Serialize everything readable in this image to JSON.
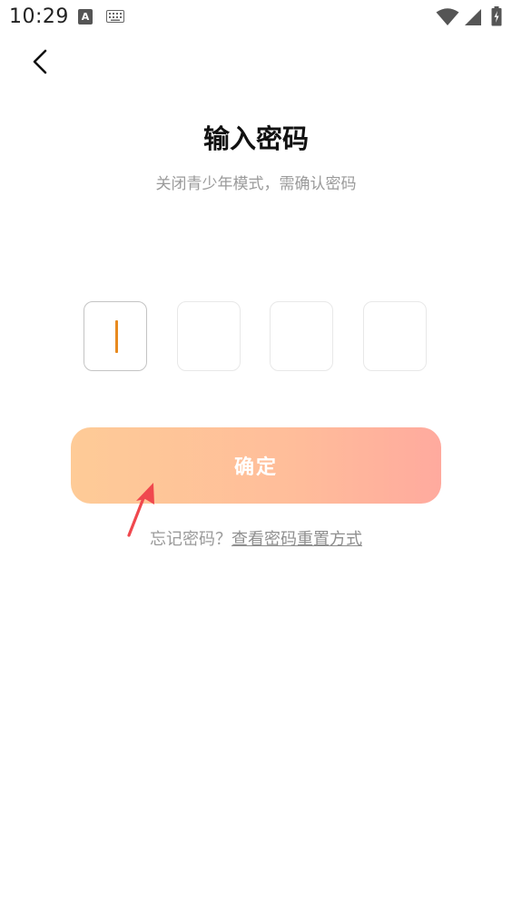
{
  "status_bar": {
    "time": "10:29",
    "a_badge": "A",
    "icons": [
      "a-notification-icon",
      "keyboard-icon",
      "wifi-icon",
      "signal-icon",
      "battery-icon"
    ]
  },
  "nav": {
    "back_icon": "chevron-left-icon"
  },
  "header": {
    "title": "输入密码",
    "subtitle": "关闭青少年模式，需确认密码"
  },
  "pin": {
    "length": 4,
    "active_index": 0,
    "cursor_color": "#e88a1f"
  },
  "actions": {
    "confirm_label": "确定",
    "confirm_gradient": [
      "#fecb97",
      "#ffaa9e"
    ]
  },
  "forgot": {
    "prefix": "忘记密码？",
    "link": "查看密码重置方式"
  },
  "annotation": {
    "arrow_color": "#f0484e",
    "arrow_icon": "pointer-arrow-icon"
  }
}
